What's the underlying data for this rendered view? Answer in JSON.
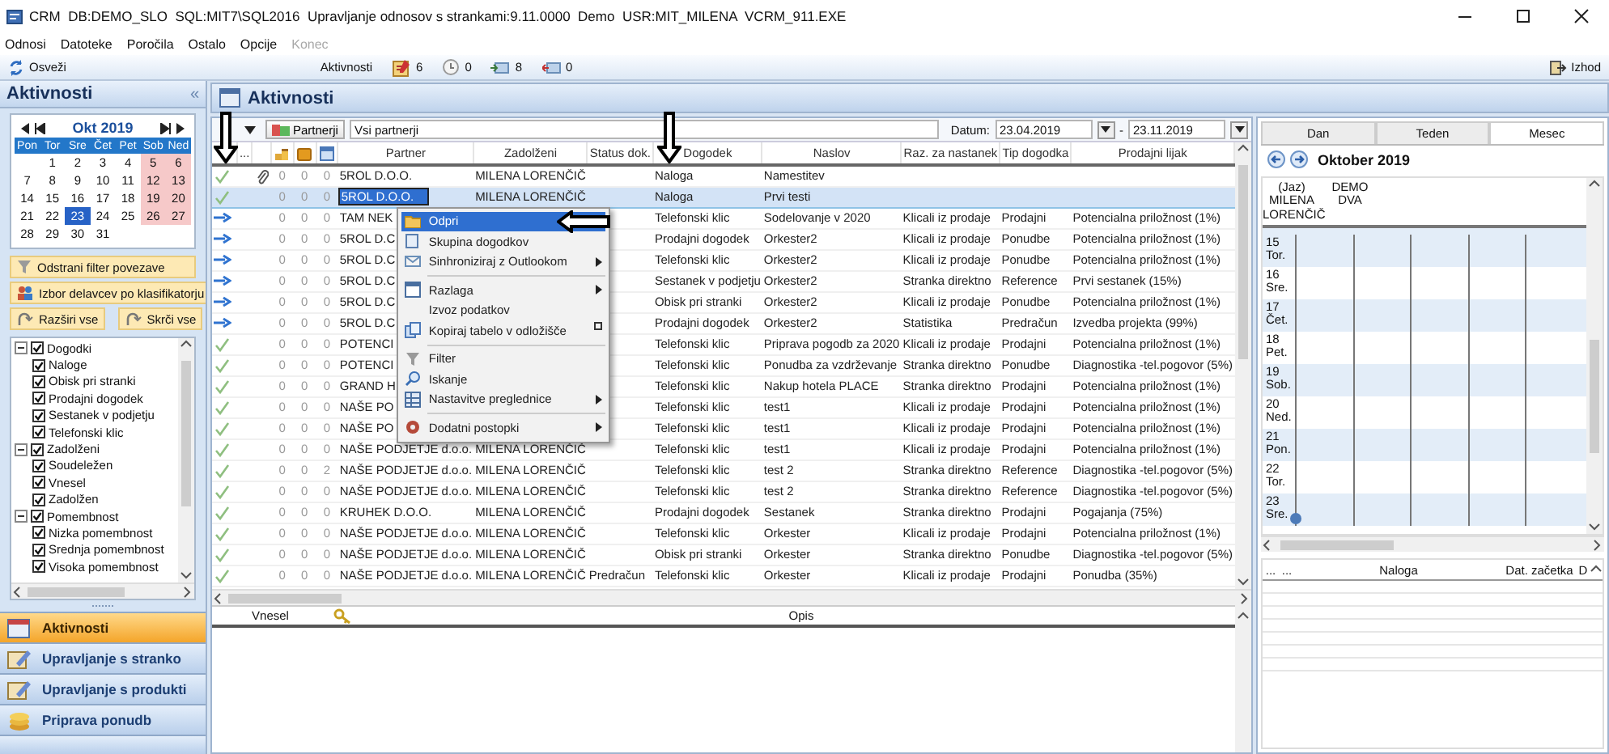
{
  "window": {
    "title": "CRM  DB:DEMO_SLO  SQL:MIT7\\SQL2016  Upravljanje odnosov s strankami:9.11.0000  Demo  USR:MIT_MILENA  VCRM_911.EXE"
  },
  "menu": [
    {
      "label": "Odnosi",
      "disabled": false
    },
    {
      "label": "Datoteke",
      "disabled": false
    },
    {
      "label": "Poročila",
      "disabled": false
    },
    {
      "label": "Ostalo",
      "disabled": false
    },
    {
      "label": "Opcije",
      "disabled": false
    },
    {
      "label": "Konec",
      "disabled": true
    }
  ],
  "toolbar": {
    "refresh": "Osveži",
    "label": "Aktivnosti",
    "indicators": [
      {
        "kind": "tasks",
        "count": "6"
      },
      {
        "kind": "clock",
        "count": "0"
      },
      {
        "kind": "incoming",
        "count": "8"
      },
      {
        "kind": "outgoing",
        "count": "0"
      }
    ],
    "exit": "Izhod"
  },
  "sidebar": {
    "title": "Aktivnosti",
    "collapse": "«",
    "calendar": {
      "month": "Okt 2019",
      "weekdays": [
        "Pon",
        "Tor",
        "Sre",
        "Čet",
        "Pet",
        "Sob",
        "Ned"
      ],
      "weeks": [
        [
          {
            "kind": "blank"
          },
          {
            "kind": "day",
            "day": "1",
            "weekend": false,
            "selected": false
          },
          {
            "kind": "day",
            "day": "2",
            "weekend": false,
            "selected": false
          },
          {
            "kind": "day",
            "day": "3",
            "weekend": false,
            "selected": false
          },
          {
            "kind": "day",
            "day": "4",
            "weekend": false,
            "selected": false
          },
          {
            "kind": "day",
            "day": "5",
            "weekend": true,
            "selected": false
          },
          {
            "kind": "day",
            "day": "6",
            "weekend": true,
            "selected": false
          }
        ],
        [
          {
            "kind": "day",
            "day": "7",
            "weekend": false,
            "selected": false
          },
          {
            "kind": "day",
            "day": "8",
            "weekend": false,
            "selected": false
          },
          {
            "kind": "day",
            "day": "9",
            "weekend": false,
            "selected": false
          },
          {
            "kind": "day",
            "day": "10",
            "weekend": false,
            "selected": false
          },
          {
            "kind": "day",
            "day": "11",
            "weekend": false,
            "selected": false
          },
          {
            "kind": "day",
            "day": "12",
            "weekend": true,
            "selected": false
          },
          {
            "kind": "day",
            "day": "13",
            "weekend": true,
            "selected": false
          }
        ],
        [
          {
            "kind": "day",
            "day": "14",
            "weekend": false,
            "selected": false
          },
          {
            "kind": "day",
            "day": "15",
            "weekend": false,
            "selected": false
          },
          {
            "kind": "day",
            "day": "16",
            "weekend": false,
            "selected": false
          },
          {
            "kind": "day",
            "day": "17",
            "weekend": false,
            "selected": false
          },
          {
            "kind": "day",
            "day": "18",
            "weekend": false,
            "selected": false
          },
          {
            "kind": "day",
            "day": "19",
            "weekend": true,
            "selected": false
          },
          {
            "kind": "day",
            "day": "20",
            "weekend": true,
            "selected": false
          }
        ],
        [
          {
            "kind": "day",
            "day": "21",
            "weekend": false,
            "selected": false
          },
          {
            "kind": "day",
            "day": "22",
            "weekend": false,
            "selected": false
          },
          {
            "kind": "day",
            "day": "23",
            "weekend": false,
            "selected": true
          },
          {
            "kind": "day",
            "day": "24",
            "weekend": false,
            "selected": false
          },
          {
            "kind": "day",
            "day": "25",
            "weekend": false,
            "selected": false
          },
          {
            "kind": "day",
            "day": "26",
            "weekend": true,
            "selected": false
          },
          {
            "kind": "day",
            "day": "27",
            "weekend": true,
            "selected": false
          }
        ],
        [
          {
            "kind": "day",
            "day": "28",
            "weekend": false,
            "selected": false
          },
          {
            "kind": "day",
            "day": "29",
            "weekend": false,
            "selected": false
          },
          {
            "kind": "day",
            "day": "30",
            "weekend": false,
            "selected": false
          },
          {
            "kind": "day",
            "day": "31",
            "weekend": false,
            "selected": false
          }
        ]
      ]
    },
    "buttons": [
      {
        "kind": "filter",
        "label": "Odstrani filter povezave"
      },
      {
        "kind": "people",
        "label": "Izbor delavcev po klasifikatorju"
      },
      {
        "kind": "expand",
        "label": "Razširi vse"
      },
      {
        "kind": "collapse",
        "label": "Skrči vse"
      }
    ],
    "tree": [
      {
        "label": "Dogodki",
        "checked": true,
        "expanded": true,
        "children": [
          {
            "label": "Naloge",
            "checked": true
          },
          {
            "label": "Obisk pri stranki",
            "checked": true
          },
          {
            "label": "Prodajni dogodek",
            "checked": true
          },
          {
            "label": "Sestanek v podjetju",
            "checked": true
          },
          {
            "label": "Telefonski klic",
            "checked": true
          }
        ]
      },
      {
        "label": "Zadolženi",
        "checked": true,
        "expanded": true,
        "children": [
          {
            "label": "Soudeležen",
            "checked": true
          },
          {
            "label": "Vnesel",
            "checked": true
          },
          {
            "label": "Zadolžen",
            "checked": true
          }
        ]
      },
      {
        "label": "Pomembnost",
        "checked": true,
        "expanded": true,
        "children": [
          {
            "label": "Nizka pomembnost",
            "checked": true
          },
          {
            "label": "Srednja pomembnost",
            "checked": true
          },
          {
            "label": "Visoka pomembnost",
            "checked": true
          }
        ]
      }
    ],
    "nav": [
      {
        "label": "Aktivnosti",
        "selected": true
      },
      {
        "label": "Upravljanje s stranko",
        "selected": false
      },
      {
        "label": "Upravljanje s produkti",
        "selected": false
      },
      {
        "label": "Priprava ponudb",
        "selected": false
      }
    ]
  },
  "panel": {
    "title": "Aktivnosti"
  },
  "filter": {
    "button": "Partnerji",
    "value": "Vsi partnerji",
    "date_label": "Datum:",
    "date_from": "23.04.2019",
    "separator": "-",
    "date_to": "23.11.2019"
  },
  "table": {
    "columns": [
      {
        "kind": "status"
      },
      {
        "kind": "text",
        "label": "..."
      },
      {
        "kind": "attachment"
      },
      {
        "kind": "coins"
      },
      {
        "kind": "box"
      },
      {
        "kind": "note"
      },
      {
        "kind": "text",
        "label": "Partner"
      },
      {
        "kind": "text",
        "label": "Zadolženi"
      },
      {
        "kind": "text",
        "label": "Status dok."
      },
      {
        "kind": "text",
        "label": "Dogodek"
      },
      {
        "kind": "text",
        "label": "Naslov"
      },
      {
        "kind": "text",
        "label": "Raz. za nastanek"
      },
      {
        "kind": "text",
        "label": "Tip dogodka"
      },
      {
        "kind": "text",
        "label": "Prodajni lijak"
      }
    ],
    "rows": [
      {
        "kind": "check",
        "attachment": true,
        "counts": [
          "0",
          "0",
          "0"
        ],
        "partner": "5ROL D.O.O.",
        "assignee": "MILENA LORENČIČ",
        "event": "Naloga",
        "title": "Namestitev",
        "selected": false,
        "editing": false
      },
      {
        "kind": "check",
        "attachment": false,
        "counts": [
          "0",
          "0",
          "0"
        ],
        "partner": "5ROL D.O.O.",
        "assignee": "MILENA LORENČIČ",
        "event": "Naloga",
        "title": "Prvi testi",
        "selected": true,
        "editing": true
      },
      {
        "kind": "arrow",
        "attachment": false,
        "counts": [
          "0",
          "0",
          "0"
        ],
        "partner": "TAM NEK",
        "event": "Telefonski klic",
        "title": "Sodelovanje v 2020",
        "source": "Klicali iz prodaje",
        "type": "Prodajni",
        "funnel": "Potencialna priložnost (1%)",
        "selected": false,
        "editing": false
      },
      {
        "kind": "arrow",
        "attachment": false,
        "counts": [
          "0",
          "0",
          "0"
        ],
        "partner": "5ROL D.C",
        "event": "Prodajni dogodek",
        "title": "Orkester2",
        "source": "Klicali iz prodaje",
        "type": "Ponudbe",
        "funnel": "Potencialna priložnost (1%)",
        "selected": false,
        "editing": false
      },
      {
        "kind": "arrow",
        "attachment": false,
        "counts": [
          "0",
          "0",
          "0"
        ],
        "partner": "5ROL D.C",
        "event": "Telefonski klic",
        "title": "Orkester2",
        "source": "Klicali iz prodaje",
        "type": "Ponudbe",
        "funnel": "Potencialna priložnost (1%)",
        "selected": false,
        "editing": false
      },
      {
        "kind": "arrow",
        "attachment": false,
        "counts": [
          "0",
          "0",
          "0"
        ],
        "partner": "5ROL D.C",
        "event": "Sestanek v podjetju",
        "title": "Orkester2",
        "source": "Stranka direktno",
        "type": "Reference",
        "funnel": "Prvi sestanek (15%)",
        "selected": false,
        "editing": false
      },
      {
        "kind": "arrow",
        "attachment": false,
        "counts": [
          "0",
          "0",
          "0"
        ],
        "partner": "5ROL D.C",
        "event": "Obisk pri stranki",
        "title": "Orkester2",
        "source": "Klicali iz prodaje",
        "type": "Ponudbe",
        "funnel": "Potencialna priložnost (1%)",
        "selected": false,
        "editing": false
      },
      {
        "kind": "arrow",
        "attachment": false,
        "counts": [
          "0",
          "0",
          "0"
        ],
        "partner": "5ROL D.C",
        "event": "Prodajni dogodek",
        "title": "Orkester2",
        "source": "Statistika",
        "type": "Predračun",
        "funnel": "Izvedba projekta (99%)",
        "selected": false,
        "editing": false
      },
      {
        "kind": "check",
        "attachment": false,
        "counts": [
          "0",
          "0",
          "0"
        ],
        "partner": "POTENCI",
        "event": "Telefonski klic",
        "title": "Priprava pogodb za 2020",
        "source": "Klicali iz prodaje",
        "type": "Prodajni",
        "funnel": "Potencialna priložnost (1%)",
        "selected": false,
        "editing": false
      },
      {
        "kind": "check",
        "attachment": false,
        "counts": [
          "0",
          "0",
          "0"
        ],
        "partner": "POTENCI",
        "event": "Telefonski klic",
        "title": "Ponudba za vzdrževanje",
        "source": "Stranka direktno",
        "type": "Ponudbe",
        "funnel": "Diagnostika -tel.pogovor (5%)",
        "selected": false,
        "editing": false
      },
      {
        "kind": "check",
        "attachment": false,
        "counts": [
          "0",
          "0",
          "0"
        ],
        "partner": "GRAND H",
        "event": "Telefonski klic",
        "title": "Nakup hotela PLACE",
        "source": "Stranka direktno",
        "type": "Prodajni",
        "funnel": "Potencialna priložnost (1%)",
        "selected": false,
        "editing": false
      },
      {
        "kind": "check",
        "attachment": false,
        "counts": [
          "0",
          "0",
          "0"
        ],
        "partner": "NAŠE PO",
        "event": "Telefonski klic",
        "title": "test1",
        "source": "Klicali iz prodaje",
        "type": "Prodajni",
        "funnel": "Potencialna priložnost (1%)",
        "selected": false,
        "editing": false
      },
      {
        "kind": "check",
        "attachment": false,
        "counts": [
          "0",
          "0",
          "0"
        ],
        "partner": "NAŠE PO",
        "event": "Telefonski klic",
        "title": "test1",
        "source": "Klicali iz prodaje",
        "type": "Prodajni",
        "funnel": "Potencialna priložnost (1%)",
        "selected": false,
        "editing": false
      },
      {
        "kind": "check",
        "attachment": false,
        "counts": [
          "0",
          "0",
          "0"
        ],
        "partner": "NAŠE PODJETJE d.o.o.",
        "assignee": "MILENA LORENČIČ",
        "event": "Telefonski klic",
        "title": "test1",
        "source": "Klicali iz prodaje",
        "type": "Prodajni",
        "funnel": "Potencialna priložnost (1%)",
        "selected": false,
        "editing": false
      },
      {
        "kind": "check",
        "attachment": false,
        "counts": [
          "0",
          "0",
          "2"
        ],
        "partner": "NAŠE PODJETJE d.o.o.",
        "assignee": "MILENA LORENČIČ",
        "event": "Telefonski klic",
        "title": "test 2",
        "source": "Stranka direktno",
        "type": "Reference",
        "funnel": "Diagnostika -tel.pogovor (5%)",
        "selected": false,
        "editing": false
      },
      {
        "kind": "check",
        "attachment": false,
        "counts": [
          "0",
          "0",
          "0"
        ],
        "partner": "NAŠE PODJETJE d.o.o.",
        "assignee": "MILENA LORENČIČ",
        "event": "Telefonski klic",
        "title": "test 2",
        "source": "Stranka direktno",
        "type": "Reference",
        "funnel": "Diagnostika -tel.pogovor (5%)",
        "selected": false,
        "editing": false
      },
      {
        "kind": "check",
        "attachment": false,
        "counts": [
          "0",
          "0",
          "0"
        ],
        "partner": "KRUHEK D.O.O.",
        "assignee": "MILENA LORENČIČ",
        "event": "Prodajni dogodek",
        "title": "Sestanek",
        "source": "Stranka direktno",
        "type": "Prodajni",
        "funnel": "Pogajanja (75%)",
        "selected": false,
        "editing": false
      },
      {
        "kind": "check",
        "attachment": false,
        "counts": [
          "0",
          "0",
          "0"
        ],
        "partner": "NAŠE PODJETJE d.o.o.",
        "assignee": "MILENA LORENČIČ",
        "event": "Telefonski klic",
        "title": "Orkester",
        "source": "Klicali iz prodaje",
        "type": "Prodajni",
        "funnel": "Potencialna priložnost (1%)",
        "selected": false,
        "editing": false
      },
      {
        "kind": "check",
        "attachment": false,
        "counts": [
          "0",
          "0",
          "0"
        ],
        "partner": "NAŠE PODJETJE d.o.o.",
        "assignee": "MILENA LORENČIČ",
        "event": "Obisk pri stranki",
        "title": "Orkester",
        "source": "Stranka direktno",
        "type": "Ponudbe",
        "funnel": "Diagnostika -tel.pogovor (5%)",
        "selected": false,
        "editing": false
      },
      {
        "kind": "check",
        "attachment": false,
        "counts": [
          "0",
          "0",
          "0"
        ],
        "partner": "NAŠE PODJETJE d.o.o.",
        "assignee": "MILENA LORENČIČ",
        "status_doc": "Predračun",
        "event": "Telefonski klic",
        "title": "Orkester",
        "source": "Klicali iz prodaje",
        "type": "Prodajni",
        "funnel": "Ponudba (35%)",
        "selected": false,
        "editing": false
      }
    ]
  },
  "context_menu": {
    "items": [
      {
        "kind": "item",
        "label": "Odpri",
        "submenu": false,
        "selected": true
      },
      {
        "kind": "item",
        "label": "Skupina dogodkov",
        "submenu": false,
        "selected": false
      },
      {
        "kind": "item",
        "label": "Sinhroniziraj z Outlookom",
        "submenu": true,
        "selected": false
      },
      {
        "kind": "separator"
      },
      {
        "kind": "item",
        "label": "Razlaga",
        "submenu": true,
        "selected": false
      },
      {
        "kind": "item",
        "label": "Izvoz podatkov",
        "submenu": false,
        "selected": false
      },
      {
        "kind": "item",
        "label": "Kopiraj tabelo v odložišče",
        "submenu": false,
        "selected": false
      },
      {
        "kind": "separator"
      },
      {
        "kind": "item",
        "label": "Filter",
        "submenu": false,
        "selected": false
      },
      {
        "kind": "item",
        "label": "Iskanje",
        "submenu": false,
        "selected": false
      },
      {
        "kind": "item",
        "label": "Nastavitve preglednice",
        "submenu": true,
        "selected": false
      },
      {
        "kind": "separator"
      },
      {
        "kind": "item",
        "label": "Dodatni postopki",
        "submenu": true,
        "selected": false
      }
    ]
  },
  "details": {
    "columns": [
      {
        "kind": "text",
        "label": "Vnesel"
      },
      {
        "kind": "key"
      },
      {
        "kind": "text",
        "label": "Opis"
      }
    ]
  },
  "calendar_view": {
    "tabs": [
      {
        "label": "Dan",
        "selected": false
      },
      {
        "label": "Teden",
        "selected": false
      },
      {
        "label": "Mesec",
        "selected": true
      }
    ],
    "month": "Oktober 2019",
    "people": [
      "(Jaz) MILENA LORENČIČ",
      "DEMO DVA"
    ],
    "days": [
      {
        "date": "15",
        "weekday": "Tor.",
        "marked": false
      },
      {
        "date": "16",
        "weekday": "Sre.",
        "marked": false
      },
      {
        "date": "17",
        "weekday": "Čet.",
        "marked": false
      },
      {
        "date": "18",
        "weekday": "Pet.",
        "marked": false
      },
      {
        "date": "19",
        "weekday": "Sob.",
        "marked": false
      },
      {
        "date": "20",
        "weekday": "Ned.",
        "marked": false
      },
      {
        "date": "21",
        "weekday": "Pon.",
        "marked": false
      },
      {
        "date": "22",
        "weekday": "Tor.",
        "marked": false
      },
      {
        "date": "23",
        "weekday": "Sre.",
        "marked": true
      }
    ]
  },
  "tasks": {
    "columns": [
      "...",
      "...",
      "Naloga",
      "Dat. začetka",
      "D"
    ]
  }
}
